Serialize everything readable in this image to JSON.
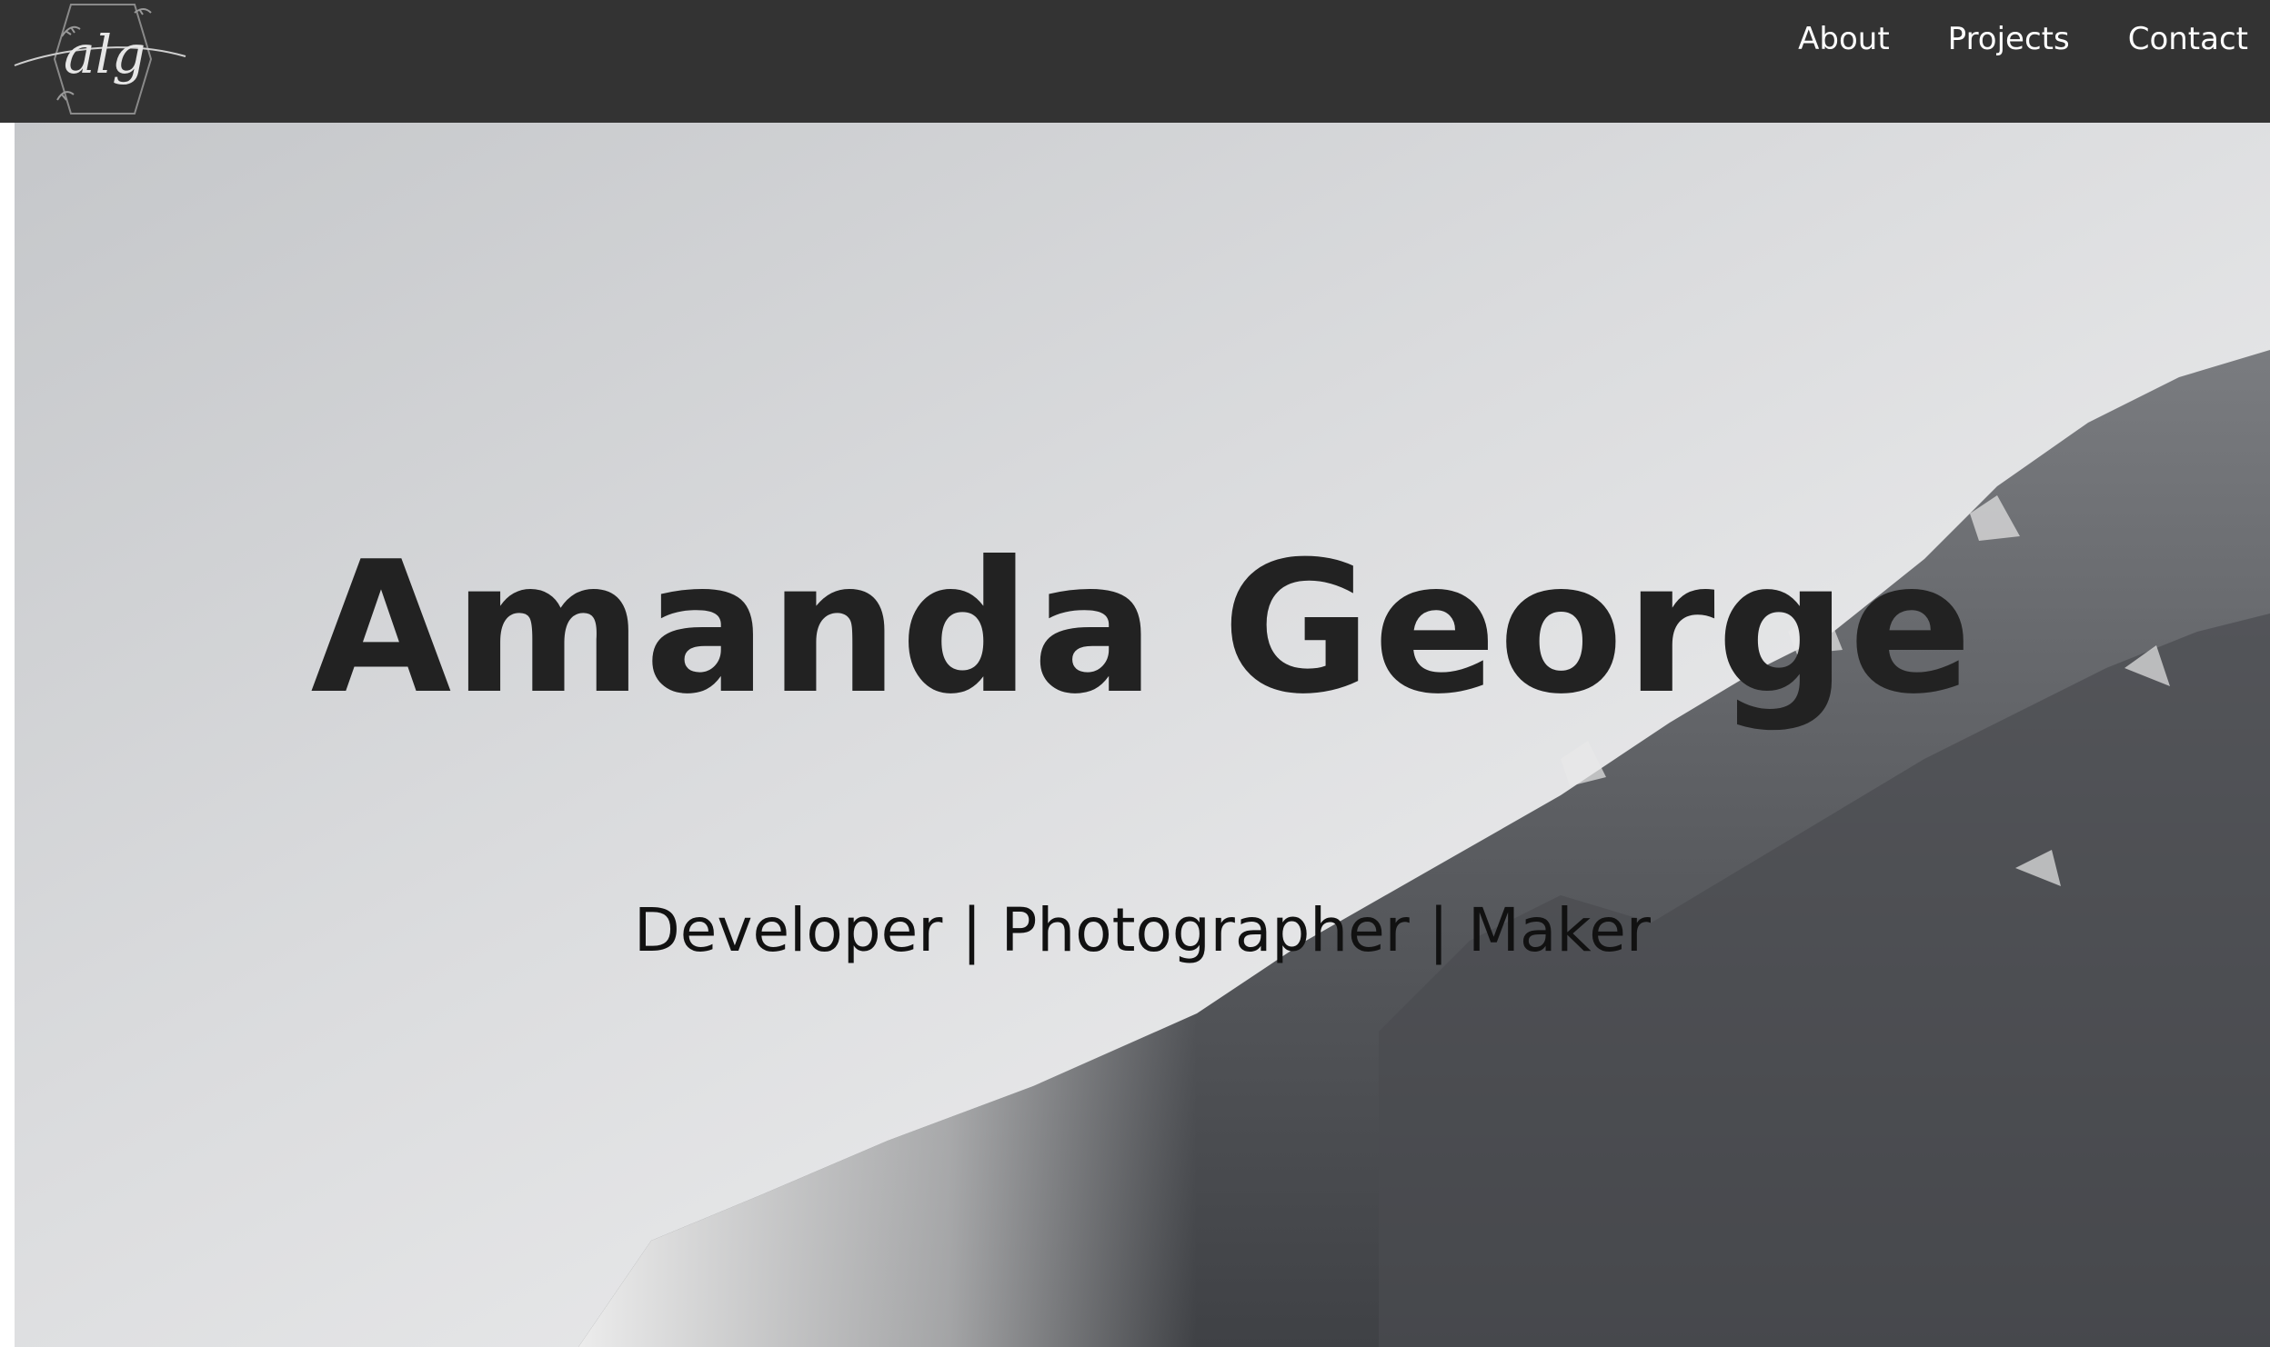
{
  "brand": {
    "logo_text": "alg"
  },
  "nav": {
    "items": [
      {
        "label": "About"
      },
      {
        "label": "Projects"
      },
      {
        "label": "Contact"
      }
    ]
  },
  "hero": {
    "title": "Amanda George",
    "subtitle": "Developer | Photographer | Maker"
  },
  "colors": {
    "navbar": "#333333",
    "nav_text": "#ffffff",
    "title_text": "#222222"
  }
}
